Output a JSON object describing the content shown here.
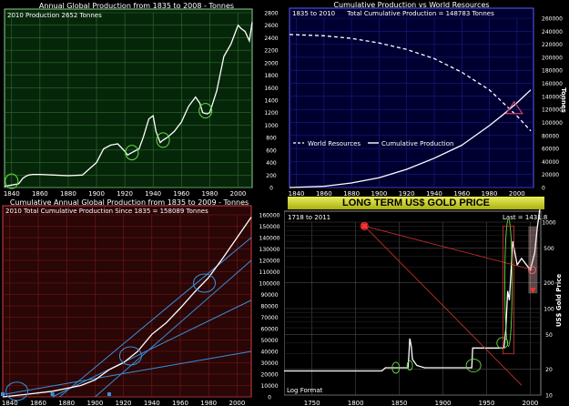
{
  "chart_data": [
    {
      "type": "line",
      "title": "Annual Global Production from 1835 to 2008 - Tonnes",
      "annotation": "2010 Production  2652  Tonnes",
      "xlabel": "",
      "ylabel": "",
      "xlim": [
        1835,
        2010
      ],
      "ylim": [
        0,
        2800
      ],
      "x_ticks": [
        "1840",
        "1860",
        "1880",
        "1900",
        "1920",
        "1940",
        "1960",
        "1980",
        "2000"
      ],
      "y_ticks": [
        "0",
        "200",
        "400",
        "600",
        "800",
        "1000",
        "1200",
        "1400",
        "1600",
        "1800",
        "2000",
        "2200",
        "2400",
        "2600",
        "2800"
      ],
      "grid": true,
      "background": "#06260a",
      "grid_color": "#2f6e2f",
      "series": [
        {
          "x": [
            1835,
            1840,
            1845,
            1848,
            1850,
            1852,
            1855,
            1860,
            1870,
            1880,
            1890,
            1895,
            1900,
            1905,
            1910,
            1915,
            1920,
            1922,
            1925,
            1930,
            1933,
            1937,
            1940,
            1942,
            1945,
            1947,
            1950,
            1955,
            1960,
            1965,
            1970,
            1973,
            1975,
            1978,
            1980,
            1985,
            1990,
            1995,
            2000,
            2002,
            2005,
            2008,
            2010
          ],
          "values": [
            20,
            40,
            60,
            150,
            180,
            200,
            210,
            210,
            200,
            190,
            200,
            300,
            400,
            620,
            680,
            700,
            580,
            520,
            560,
            620,
            800,
            1100,
            1150,
            900,
            720,
            760,
            800,
            900,
            1050,
            1300,
            1450,
            1350,
            1200,
            1180,
            1200,
            1550,
            2100,
            2300,
            2600,
            2550,
            2500,
            2350,
            2650
          ]
        }
      ],
      "markers": [
        {
          "x": 1840,
          "y": 100
        },
        {
          "x": 1925,
          "y": 560
        },
        {
          "x": 1947,
          "y": 760
        },
        {
          "x": 1977,
          "y": 1230
        }
      ]
    },
    {
      "type": "line",
      "title": "Cumulative Production vs World Resources",
      "annotation_left": "1835 to 2010",
      "annotation": "Total Cumulative Production = 148783  Tonnes",
      "xlabel": "",
      "ylabel": "Tonnes",
      "xlim": [
        1835,
        2012
      ],
      "ylim": [
        0,
        260000
      ],
      "x_ticks": [
        "1840",
        "1860",
        "1880",
        "1900",
        "1920",
        "1940",
        "1960",
        "1980",
        "2000"
      ],
      "y_ticks": [
        "0",
        "20000",
        "40000",
        "60000",
        "80000",
        "100000",
        "120000",
        "140000",
        "160000",
        "180000",
        "200000",
        "220000",
        "240000",
        "260000"
      ],
      "grid": true,
      "background": "#000030",
      "grid_color": "#1b1b8a",
      "legend": "bottom-left",
      "series": [
        {
          "name": "World Resources",
          "style": "dashed",
          "x": [
            1835,
            1860,
            1880,
            1900,
            1920,
            1940,
            1960,
            1980,
            1990,
            2000,
            2010
          ],
          "values": [
            235000,
            233000,
            229000,
            222000,
            212000,
            198000,
            177000,
            150000,
            130000,
            110000,
            87000
          ]
        },
        {
          "name": "Cumulative Production",
          "style": "solid",
          "x": [
            1835,
            1860,
            1880,
            1900,
            1920,
            1940,
            1960,
            1980,
            1990,
            2000,
            2010
          ],
          "values": [
            0,
            2000,
            7000,
            15000,
            28000,
            45000,
            65000,
            95000,
            112000,
            130000,
            150000
          ]
        }
      ],
      "triangle_marker": {
        "x": 1998,
        "y": 122000
      }
    },
    {
      "type": "line",
      "title": "Cumulative Annual Global Production from 1835 to 2009 - Tonnes",
      "annotation": "2010 Total Cumulative Production Since 1835 = 158089  Tonnes",
      "xlabel": "",
      "ylabel": "",
      "xlim": [
        1835,
        2010
      ],
      "ylim": [
        0,
        160000
      ],
      "x_ticks": [
        "1840",
        "1860",
        "1880",
        "1900",
        "1920",
        "1940",
        "1960",
        "1980",
        "2000"
      ],
      "y_ticks": [
        "0",
        "10000",
        "20000",
        "30000",
        "40000",
        "50000",
        "60000",
        "70000",
        "80000",
        "90000",
        "100000",
        "110000",
        "120000",
        "130000",
        "140000",
        "150000",
        "160000"
      ],
      "grid": true,
      "background": "#2a0606",
      "grid_color": "#7a1a1a",
      "series": [
        {
          "x": [
            1835,
            1850,
            1870,
            1890,
            1900,
            1910,
            1920,
            1930,
            1940,
            1950,
            1960,
            1970,
            1980,
            1990,
            2000,
            2010
          ],
          "values": [
            0,
            2000,
            5000,
            10000,
            15000,
            24000,
            30000,
            40000,
            55000,
            65000,
            78000,
            92000,
            105000,
            122000,
            140000,
            158000
          ]
        }
      ],
      "trend_lines": [
        {
          "from": {
            "x": 1835,
            "y": 2000
          },
          "to": {
            "x": 2010,
            "y": 40000
          }
        },
        {
          "from": {
            "x": 1870,
            "y": 0
          },
          "to": {
            "x": 2010,
            "y": 85000
          }
        },
        {
          "from": {
            "x": 1900,
            "y": 0
          },
          "to": {
            "x": 2010,
            "y": 120000
          }
        },
        {
          "from": {
            "x": 1875,
            "y": 0
          },
          "to": {
            "x": 2010,
            "y": 140000
          }
        }
      ],
      "markers": [
        {
          "x": 1845,
          "y": 5000
        },
        {
          "x": 1925,
          "y": 36000
        },
        {
          "x": 1977,
          "y": 100000
        }
      ],
      "start_points": [
        {
          "x": 1835,
          "y": 0
        },
        {
          "x": 1870,
          "y": 0
        },
        {
          "x": 1910,
          "y": 0
        }
      ]
    },
    {
      "type": "line",
      "title": "LONG TERM US$ GOLD PRICE",
      "annotation_left": "1718 to 2011",
      "annotation": "Last = 1431.8",
      "footnote": "Log Format",
      "xlabel": "",
      "ylabel": "US$ Gold Price",
      "xlim": [
        1718,
        2012
      ],
      "ylim": [
        10,
        1000
      ],
      "log_y": true,
      "x_ticks": [
        "1750",
        "1800",
        "1850",
        "1900",
        "1950",
        "2000"
      ],
      "y_ticks": [
        "10",
        "20",
        "50",
        "100",
        "200",
        "500",
        "1000"
      ],
      "grid": true,
      "background": "#000000",
      "grid_color": "#4a4a4a",
      "series": [
        {
          "x": [
            1718,
            1750,
            1780,
            1800,
            1830,
            1834,
            1850,
            1860,
            1861,
            1862,
            1863,
            1864,
            1865,
            1870,
            1879,
            1900,
            1933,
            1934,
            1940,
            1968,
            1970,
            1972,
            1974,
            1976,
            1980,
            1985,
            1990,
            2000,
            2005,
            2008,
            2011
          ],
          "values": [
            19,
            19,
            19,
            19,
            19,
            20.7,
            20.7,
            20.7,
            30,
            45,
            40,
            35,
            26,
            22,
            20.67,
            20.67,
            20.67,
            35,
            35,
            35,
            36,
            58,
            160,
            125,
            600,
            320,
            380,
            280,
            440,
            870,
            1431.8
          ]
        }
      ],
      "markers": [
        {
          "x": 1810,
          "y": 900
        },
        {
          "x": 2002,
          "y": 280
        }
      ]
    }
  ]
}
